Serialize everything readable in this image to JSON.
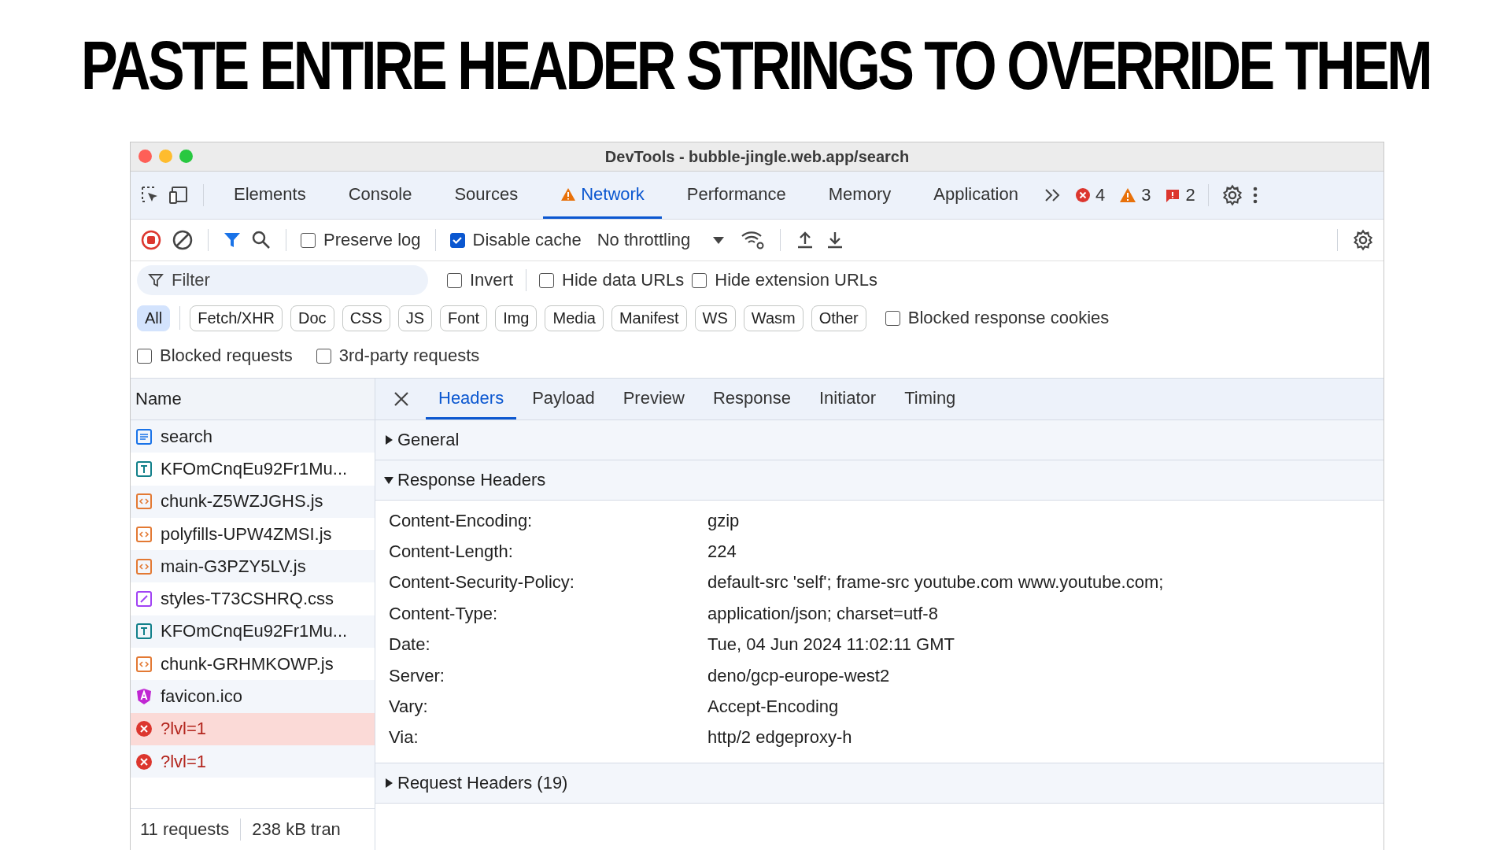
{
  "headline": "PASTE ENTIRE HEADER STRINGS TO OVERRIDE THEM",
  "window": {
    "title": "DevTools - bubble-jingle.web.app/search"
  },
  "panel_tabs": [
    {
      "label": "Elements",
      "selected": false,
      "warning": false
    },
    {
      "label": "Console",
      "selected": false,
      "warning": false
    },
    {
      "label": "Sources",
      "selected": false,
      "warning": false
    },
    {
      "label": "Network",
      "selected": true,
      "warning": true
    },
    {
      "label": "Performance",
      "selected": false,
      "warning": false
    },
    {
      "label": "Memory",
      "selected": false,
      "warning": false
    },
    {
      "label": "Application",
      "selected": false,
      "warning": false
    }
  ],
  "status_counts": [
    {
      "kind": "error",
      "count": "4"
    },
    {
      "kind": "warning",
      "count": "3"
    },
    {
      "kind": "issue",
      "count": "2"
    }
  ],
  "toolbar": {
    "preserve_log": {
      "label": "Preserve log",
      "checked": false
    },
    "disable_cache": {
      "label": "Disable cache",
      "checked": true
    },
    "throttling": "No throttling"
  },
  "filter": {
    "placeholder": "Filter",
    "options": [
      {
        "label": "Invert",
        "checked": false
      },
      {
        "label": "Hide data URLs",
        "checked": false
      },
      {
        "label": "Hide extension URLs",
        "checked": false
      }
    ]
  },
  "type_filters": [
    {
      "label": "All",
      "selected": true
    },
    {
      "label": "Fetch/XHR",
      "selected": false
    },
    {
      "label": "Doc",
      "selected": false
    },
    {
      "label": "CSS",
      "selected": false
    },
    {
      "label": "JS",
      "selected": false
    },
    {
      "label": "Font",
      "selected": false
    },
    {
      "label": "Img",
      "selected": false
    },
    {
      "label": "Media",
      "selected": false
    },
    {
      "label": "Manifest",
      "selected": false
    },
    {
      "label": "WS",
      "selected": false
    },
    {
      "label": "Wasm",
      "selected": false
    },
    {
      "label": "Other",
      "selected": false
    }
  ],
  "blocked_cookies": {
    "label": "Blocked response cookies",
    "checked": false
  },
  "extra_filters": [
    {
      "label": "Blocked requests",
      "checked": false
    },
    {
      "label": "3rd-party requests",
      "checked": false
    }
  ],
  "requests": {
    "column": "Name",
    "rows": [
      {
        "name": "search",
        "kind": "document",
        "selected": false
      },
      {
        "name": "KFOmCnqEu92Fr1Mu...",
        "kind": "font",
        "selected": false
      },
      {
        "name": "chunk-Z5WZJGHS.js",
        "kind": "script",
        "selected": false
      },
      {
        "name": "polyfills-UPW4ZMSI.js",
        "kind": "script",
        "selected": false
      },
      {
        "name": "main-G3PZY5LV.js",
        "kind": "script",
        "selected": false
      },
      {
        "name": "styles-T73CSHRQ.css",
        "kind": "stylesheet",
        "selected": false
      },
      {
        "name": "KFOmCnqEu92Fr1Mu...",
        "kind": "font",
        "selected": false
      },
      {
        "name": "chunk-GRHMKOWP.js",
        "kind": "script",
        "selected": false
      },
      {
        "name": "favicon.ico",
        "kind": "favicon",
        "selected": false
      },
      {
        "name": "?lvl=1",
        "kind": "error",
        "selected": true
      },
      {
        "name": "?lvl=1",
        "kind": "error",
        "selected": false
      }
    ]
  },
  "footer": [
    "11 requests",
    "238 kB tran"
  ],
  "detail_tabs": [
    {
      "label": "Headers",
      "selected": true
    },
    {
      "label": "Payload",
      "selected": false
    },
    {
      "label": "Preview",
      "selected": false
    },
    {
      "label": "Response",
      "selected": false
    },
    {
      "label": "Initiator",
      "selected": false
    },
    {
      "label": "Timing",
      "selected": false
    }
  ],
  "sections": [
    {
      "title": "General",
      "expanded": false
    },
    {
      "title": "Response Headers",
      "expanded": true,
      "headers": [
        {
          "name": "Content-Encoding:",
          "value": "gzip"
        },
        {
          "name": "Content-Length:",
          "value": "224"
        },
        {
          "name": "Content-Security-Policy:",
          "value": "default-src 'self'; frame-src youtube.com www.youtube.com;"
        },
        {
          "name": "Content-Type:",
          "value": "application/json; charset=utf-8"
        },
        {
          "name": "Date:",
          "value": "Tue, 04 Jun 2024 11:02:11 GMT"
        },
        {
          "name": "Server:",
          "value": "deno/gcp-europe-west2"
        },
        {
          "name": "Vary:",
          "value": "Accept-Encoding"
        },
        {
          "name": "Via:",
          "value": "http/2 edgeproxy-h"
        }
      ]
    },
    {
      "title": "Request Headers (19)",
      "expanded": false
    }
  ]
}
